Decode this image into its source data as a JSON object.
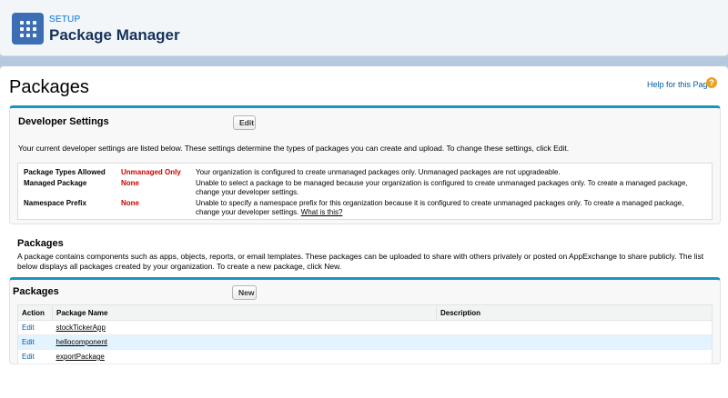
{
  "header": {
    "setup_label": "SETUP",
    "page_heading": "Package Manager"
  },
  "main": {
    "title": "Packages",
    "help_link": "Help for this Page",
    "help_icon": "help-question-icon"
  },
  "developer_settings": {
    "title": "Developer Settings",
    "edit_label": "Edit",
    "description": "Your current developer settings are listed below. These settings determine the types of packages you can create and upload. To change these settings, click Edit.",
    "rows": [
      {
        "label": "Package Types Allowed",
        "value": "Unmanaged Only",
        "description": "Your organization is configured to create unmanaged packages only. Unmanaged packages are not upgradeable."
      },
      {
        "label": "Managed Package",
        "value": "None",
        "description": "Unable to select a package to be managed because your organization is configured to create unmanaged packages only. To create a managed package, change your developer settings."
      },
      {
        "label": "Namespace Prefix",
        "value": "None",
        "description": "Unable to specify a namespace prefix for this organization because it is configured to create unmanaged packages only. To create a managed package, change your developer settings.",
        "link": "What is this?"
      }
    ]
  },
  "packages_info": {
    "heading": "Packages",
    "description": "A package contains components such as apps, objects, reports, or email templates. These packages can be uploaded to share with others privately or posted on AppExchange to share publicly. The list below displays all packages created by your organization. To create a new package, click New."
  },
  "packages_table": {
    "title": "Packages",
    "new_label": "New",
    "columns": [
      "Action",
      "Package Name",
      "Description"
    ],
    "rows": [
      {
        "action": "Edit",
        "name": "stockTickerApp",
        "description": ""
      },
      {
        "action": "Edit",
        "name": "hellocomponent",
        "description": ""
      },
      {
        "action": "Edit",
        "name": "exportPackage",
        "description": ""
      }
    ]
  },
  "colors": {
    "accent": "#1797c0",
    "link": "#015ba7",
    "value_red": "#cc0000",
    "app_icon": "#3c6eb5"
  }
}
